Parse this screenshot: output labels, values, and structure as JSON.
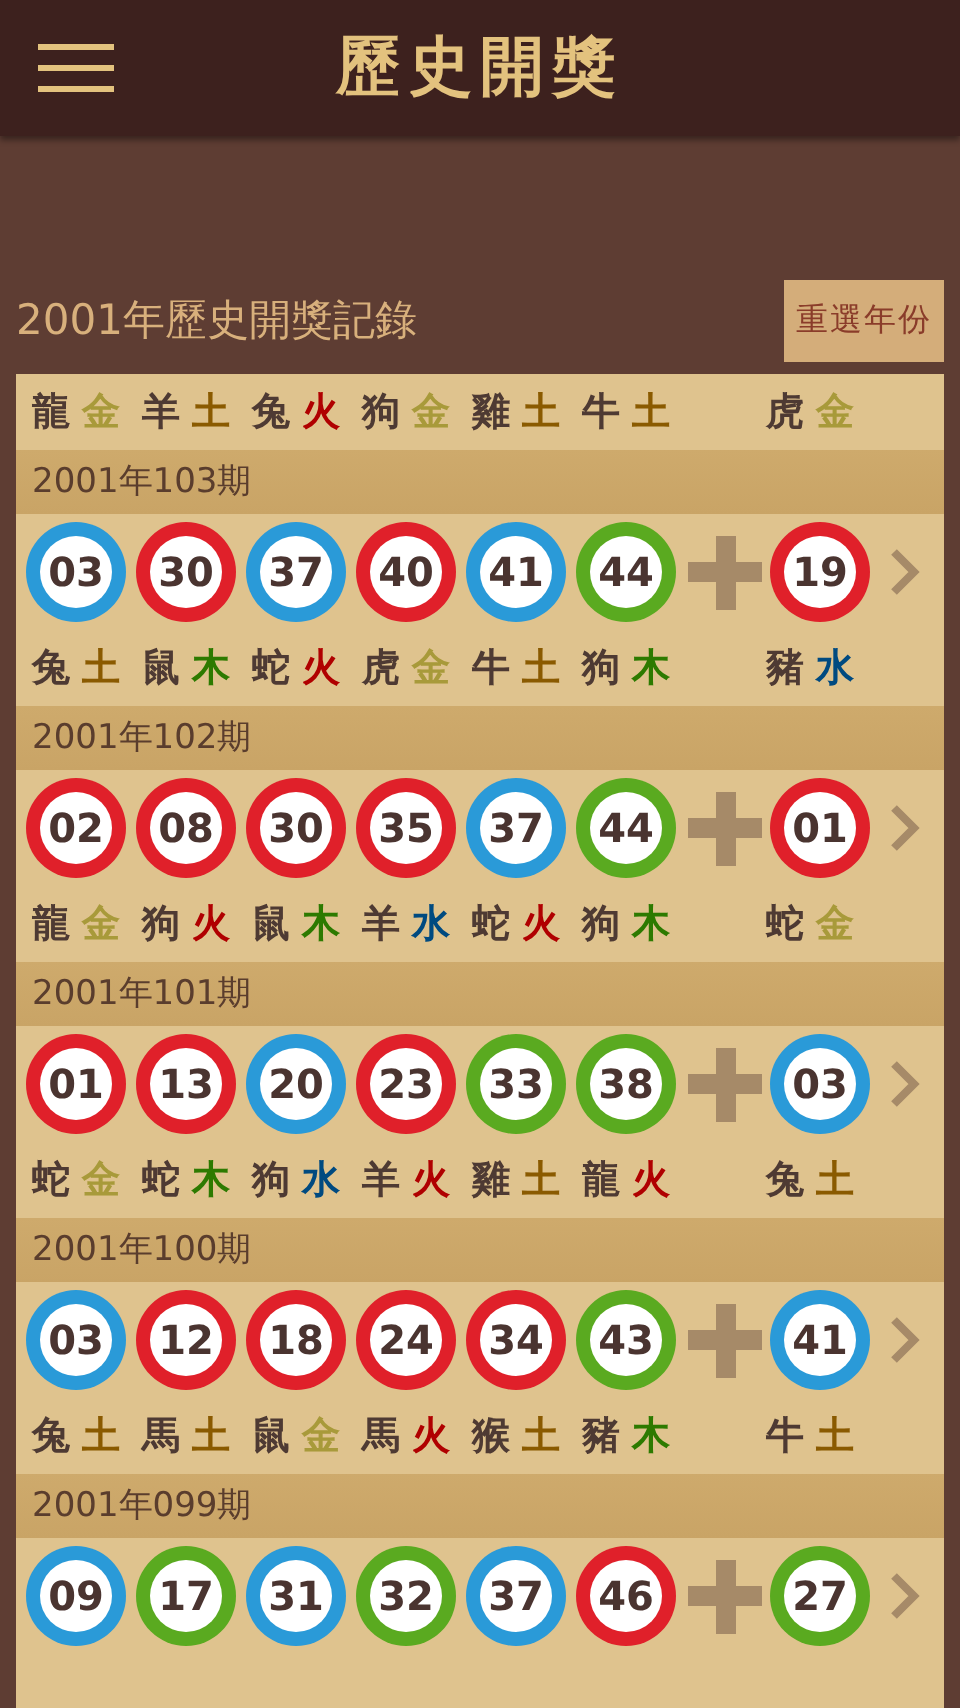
{
  "app_bar": {
    "title": "歷史開獎"
  },
  "section": {
    "title": "2001年歷史開獎記錄",
    "button": "重選年份"
  },
  "records": [
    {
      "zodiac": [
        {
          "animal": "龍",
          "element": "金",
          "color": "#a89a3a"
        },
        {
          "animal": "羊",
          "element": "土",
          "color": "#8a5a00"
        },
        {
          "animal": "兔",
          "element": "火",
          "color": "#b00000"
        },
        {
          "animal": "狗",
          "element": "金",
          "color": "#a89a3a"
        },
        {
          "animal": "雞",
          "element": "土",
          "color": "#8a5a00"
        },
        {
          "animal": "牛",
          "element": "土",
          "color": "#8a5a00"
        },
        {
          "animal": "虎",
          "element": "金",
          "color": "#a89a3a"
        }
      ]
    },
    {
      "period": "2001年103期",
      "balls": [
        {
          "number": "03",
          "color": "#2a9ad8"
        },
        {
          "number": "30",
          "color": "#e0202a"
        },
        {
          "number": "37",
          "color": "#2a9ad8"
        },
        {
          "number": "40",
          "color": "#e0202a"
        },
        {
          "number": "41",
          "color": "#2a9ad8"
        },
        {
          "number": "44",
          "color": "#5aaa20"
        },
        {
          "number": "19",
          "color": "#e0202a"
        }
      ],
      "zodiac": [
        {
          "animal": "兔",
          "element": "土",
          "color": "#8a5a00"
        },
        {
          "animal": "鼠",
          "element": "木",
          "color": "#2d7a00"
        },
        {
          "animal": "蛇",
          "element": "火",
          "color": "#b00000"
        },
        {
          "animal": "虎",
          "element": "金",
          "color": "#a89a3a"
        },
        {
          "animal": "牛",
          "element": "土",
          "color": "#8a5a00"
        },
        {
          "animal": "狗",
          "element": "木",
          "color": "#2d7a00"
        },
        {
          "animal": "豬",
          "element": "水",
          "color": "#004a80"
        }
      ]
    },
    {
      "period": "2001年102期",
      "balls": [
        {
          "number": "02",
          "color": "#e0202a"
        },
        {
          "number": "08",
          "color": "#e0202a"
        },
        {
          "number": "30",
          "color": "#e0202a"
        },
        {
          "number": "35",
          "color": "#e0202a"
        },
        {
          "number": "37",
          "color": "#2a9ad8"
        },
        {
          "number": "44",
          "color": "#5aaa20"
        },
        {
          "number": "01",
          "color": "#e0202a"
        }
      ],
      "zodiac": [
        {
          "animal": "龍",
          "element": "金",
          "color": "#a89a3a"
        },
        {
          "animal": "狗",
          "element": "火",
          "color": "#b00000"
        },
        {
          "animal": "鼠",
          "element": "木",
          "color": "#2d7a00"
        },
        {
          "animal": "羊",
          "element": "水",
          "color": "#004a80"
        },
        {
          "animal": "蛇",
          "element": "火",
          "color": "#b00000"
        },
        {
          "animal": "狗",
          "element": "木",
          "color": "#2d7a00"
        },
        {
          "animal": "蛇",
          "element": "金",
          "color": "#a89a3a"
        }
      ]
    },
    {
      "period": "2001年101期",
      "balls": [
        {
          "number": "01",
          "color": "#e0202a"
        },
        {
          "number": "13",
          "color": "#e0202a"
        },
        {
          "number": "20",
          "color": "#2a9ad8"
        },
        {
          "number": "23",
          "color": "#e0202a"
        },
        {
          "number": "33",
          "color": "#5aaa20"
        },
        {
          "number": "38",
          "color": "#5aaa20"
        },
        {
          "number": "03",
          "color": "#2a9ad8"
        }
      ],
      "zodiac": [
        {
          "animal": "蛇",
          "element": "金",
          "color": "#a89a3a"
        },
        {
          "animal": "蛇",
          "element": "木",
          "color": "#2d7a00"
        },
        {
          "animal": "狗",
          "element": "水",
          "color": "#004a80"
        },
        {
          "animal": "羊",
          "element": "火",
          "color": "#b00000"
        },
        {
          "animal": "雞",
          "element": "土",
          "color": "#8a5a00"
        },
        {
          "animal": "龍",
          "element": "火",
          "color": "#b00000"
        },
        {
          "animal": "兔",
          "element": "土",
          "color": "#8a5a00"
        }
      ]
    },
    {
      "period": "2001年100期",
      "balls": [
        {
          "number": "03",
          "color": "#2a9ad8"
        },
        {
          "number": "12",
          "color": "#e0202a"
        },
        {
          "number": "18",
          "color": "#e0202a"
        },
        {
          "number": "24",
          "color": "#e0202a"
        },
        {
          "number": "34",
          "color": "#e0202a"
        },
        {
          "number": "43",
          "color": "#5aaa20"
        },
        {
          "number": "41",
          "color": "#2a9ad8"
        }
      ],
      "zodiac": [
        {
          "animal": "兔",
          "element": "土",
          "color": "#8a5a00"
        },
        {
          "animal": "馬",
          "element": "土",
          "color": "#8a5a00"
        },
        {
          "animal": "鼠",
          "element": "金",
          "color": "#a89a3a"
        },
        {
          "animal": "馬",
          "element": "火",
          "color": "#b00000"
        },
        {
          "animal": "猴",
          "element": "土",
          "color": "#8a5a00"
        },
        {
          "animal": "豬",
          "element": "木",
          "color": "#2d7a00"
        },
        {
          "animal": "牛",
          "element": "土",
          "color": "#8a5a00"
        }
      ]
    },
    {
      "period": "2001年099期",
      "balls": [
        {
          "number": "09",
          "color": "#2a9ad8"
        },
        {
          "number": "17",
          "color": "#5aaa20"
        },
        {
          "number": "31",
          "color": "#2a9ad8"
        },
        {
          "number": "32",
          "color": "#5aaa20"
        },
        {
          "number": "37",
          "color": "#2a9ad8"
        },
        {
          "number": "46",
          "color": "#e0202a"
        },
        {
          "number": "27",
          "color": "#5aaa20"
        }
      ]
    }
  ]
}
